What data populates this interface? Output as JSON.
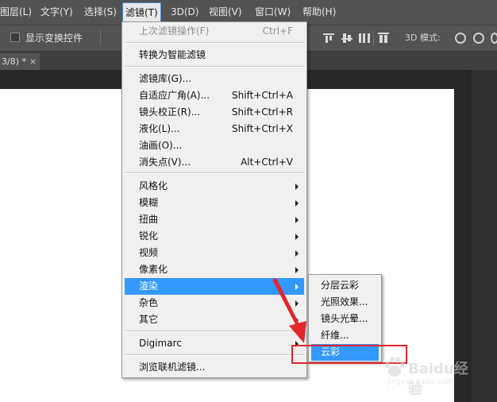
{
  "menubar": {
    "items": [
      {
        "label": "图层(L)"
      },
      {
        "label": "文字(Y)"
      },
      {
        "label": "选择(S)"
      },
      {
        "label": "滤镜(T)"
      },
      {
        "label": "3D(D)"
      },
      {
        "label": "视图(V)"
      },
      {
        "label": "窗口(W)"
      },
      {
        "label": "帮助(H)"
      }
    ]
  },
  "options": {
    "show_transform_label": "显示变换控件",
    "mode_label": "3D 模式:"
  },
  "tab": {
    "title": "3/8) *",
    "close": "×"
  },
  "filter_menu": {
    "items": [
      {
        "label": "上次滤镜操作(F)",
        "shortcut": "Ctrl+F"
      },
      {
        "label": "转换为智能滤镜"
      },
      {
        "label": "滤镜库(G)..."
      },
      {
        "label": "自适应广角(A)...",
        "shortcut": "Shift+Ctrl+A"
      },
      {
        "label": "镜头校正(R)...",
        "shortcut": "Shift+Ctrl+R"
      },
      {
        "label": "液化(L)...",
        "shortcut": "Shift+Ctrl+X"
      },
      {
        "label": "油画(O)..."
      },
      {
        "label": "消失点(V)...",
        "shortcut": "Alt+Ctrl+V"
      },
      {
        "label": "风格化"
      },
      {
        "label": "模糊"
      },
      {
        "label": "扭曲"
      },
      {
        "label": "锐化"
      },
      {
        "label": "视频"
      },
      {
        "label": "像素化"
      },
      {
        "label": "渲染"
      },
      {
        "label": "杂色"
      },
      {
        "label": "其它"
      },
      {
        "label": "Digimarc"
      },
      {
        "label": "浏览联机滤镜..."
      }
    ]
  },
  "render_submenu": {
    "items": [
      {
        "label": "分层云彩"
      },
      {
        "label": "光照效果..."
      },
      {
        "label": "镜头光晕..."
      },
      {
        "label": "纤维..."
      },
      {
        "label": "云彩"
      }
    ]
  },
  "watermark": {
    "text": "Baidu经验",
    "sub": "jingyan.baidu.com"
  },
  "colors": {
    "highlight": "#3399ff",
    "annotation_red": "#e4262b",
    "chrome": "#535353"
  }
}
